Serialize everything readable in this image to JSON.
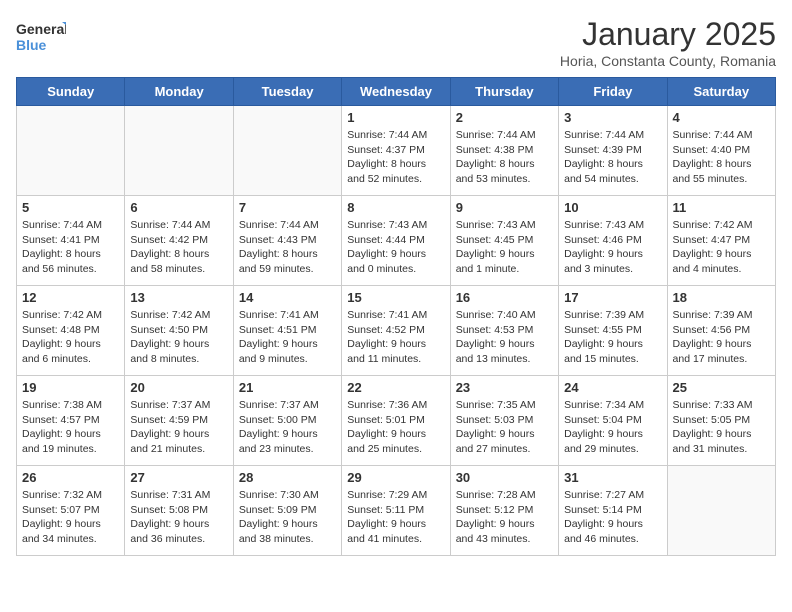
{
  "logo": {
    "line1": "General",
    "line2": "Blue"
  },
  "title": "January 2025",
  "location": "Horia, Constanta County, Romania",
  "headers": [
    "Sunday",
    "Monday",
    "Tuesday",
    "Wednesday",
    "Thursday",
    "Friday",
    "Saturday"
  ],
  "weeks": [
    [
      {
        "day": "",
        "info": ""
      },
      {
        "day": "",
        "info": ""
      },
      {
        "day": "",
        "info": ""
      },
      {
        "day": "1",
        "info": "Sunrise: 7:44 AM\nSunset: 4:37 PM\nDaylight: 8 hours\nand 52 minutes."
      },
      {
        "day": "2",
        "info": "Sunrise: 7:44 AM\nSunset: 4:38 PM\nDaylight: 8 hours\nand 53 minutes."
      },
      {
        "day": "3",
        "info": "Sunrise: 7:44 AM\nSunset: 4:39 PM\nDaylight: 8 hours\nand 54 minutes."
      },
      {
        "day": "4",
        "info": "Sunrise: 7:44 AM\nSunset: 4:40 PM\nDaylight: 8 hours\nand 55 minutes."
      }
    ],
    [
      {
        "day": "5",
        "info": "Sunrise: 7:44 AM\nSunset: 4:41 PM\nDaylight: 8 hours\nand 56 minutes."
      },
      {
        "day": "6",
        "info": "Sunrise: 7:44 AM\nSunset: 4:42 PM\nDaylight: 8 hours\nand 58 minutes."
      },
      {
        "day": "7",
        "info": "Sunrise: 7:44 AM\nSunset: 4:43 PM\nDaylight: 8 hours\nand 59 minutes."
      },
      {
        "day": "8",
        "info": "Sunrise: 7:43 AM\nSunset: 4:44 PM\nDaylight: 9 hours\nand 0 minutes."
      },
      {
        "day": "9",
        "info": "Sunrise: 7:43 AM\nSunset: 4:45 PM\nDaylight: 9 hours\nand 1 minute."
      },
      {
        "day": "10",
        "info": "Sunrise: 7:43 AM\nSunset: 4:46 PM\nDaylight: 9 hours\nand 3 minutes."
      },
      {
        "day": "11",
        "info": "Sunrise: 7:42 AM\nSunset: 4:47 PM\nDaylight: 9 hours\nand 4 minutes."
      }
    ],
    [
      {
        "day": "12",
        "info": "Sunrise: 7:42 AM\nSunset: 4:48 PM\nDaylight: 9 hours\nand 6 minutes."
      },
      {
        "day": "13",
        "info": "Sunrise: 7:42 AM\nSunset: 4:50 PM\nDaylight: 9 hours\nand 8 minutes."
      },
      {
        "day": "14",
        "info": "Sunrise: 7:41 AM\nSunset: 4:51 PM\nDaylight: 9 hours\nand 9 minutes."
      },
      {
        "day": "15",
        "info": "Sunrise: 7:41 AM\nSunset: 4:52 PM\nDaylight: 9 hours\nand 11 minutes."
      },
      {
        "day": "16",
        "info": "Sunrise: 7:40 AM\nSunset: 4:53 PM\nDaylight: 9 hours\nand 13 minutes."
      },
      {
        "day": "17",
        "info": "Sunrise: 7:39 AM\nSunset: 4:55 PM\nDaylight: 9 hours\nand 15 minutes."
      },
      {
        "day": "18",
        "info": "Sunrise: 7:39 AM\nSunset: 4:56 PM\nDaylight: 9 hours\nand 17 minutes."
      }
    ],
    [
      {
        "day": "19",
        "info": "Sunrise: 7:38 AM\nSunset: 4:57 PM\nDaylight: 9 hours\nand 19 minutes."
      },
      {
        "day": "20",
        "info": "Sunrise: 7:37 AM\nSunset: 4:59 PM\nDaylight: 9 hours\nand 21 minutes."
      },
      {
        "day": "21",
        "info": "Sunrise: 7:37 AM\nSunset: 5:00 PM\nDaylight: 9 hours\nand 23 minutes."
      },
      {
        "day": "22",
        "info": "Sunrise: 7:36 AM\nSunset: 5:01 PM\nDaylight: 9 hours\nand 25 minutes."
      },
      {
        "day": "23",
        "info": "Sunrise: 7:35 AM\nSunset: 5:03 PM\nDaylight: 9 hours\nand 27 minutes."
      },
      {
        "day": "24",
        "info": "Sunrise: 7:34 AM\nSunset: 5:04 PM\nDaylight: 9 hours\nand 29 minutes."
      },
      {
        "day": "25",
        "info": "Sunrise: 7:33 AM\nSunset: 5:05 PM\nDaylight: 9 hours\nand 31 minutes."
      }
    ],
    [
      {
        "day": "26",
        "info": "Sunrise: 7:32 AM\nSunset: 5:07 PM\nDaylight: 9 hours\nand 34 minutes."
      },
      {
        "day": "27",
        "info": "Sunrise: 7:31 AM\nSunset: 5:08 PM\nDaylight: 9 hours\nand 36 minutes."
      },
      {
        "day": "28",
        "info": "Sunrise: 7:30 AM\nSunset: 5:09 PM\nDaylight: 9 hours\nand 38 minutes."
      },
      {
        "day": "29",
        "info": "Sunrise: 7:29 AM\nSunset: 5:11 PM\nDaylight: 9 hours\nand 41 minutes."
      },
      {
        "day": "30",
        "info": "Sunrise: 7:28 AM\nSunset: 5:12 PM\nDaylight: 9 hours\nand 43 minutes."
      },
      {
        "day": "31",
        "info": "Sunrise: 7:27 AM\nSunset: 5:14 PM\nDaylight: 9 hours\nand 46 minutes."
      },
      {
        "day": "",
        "info": ""
      }
    ]
  ]
}
